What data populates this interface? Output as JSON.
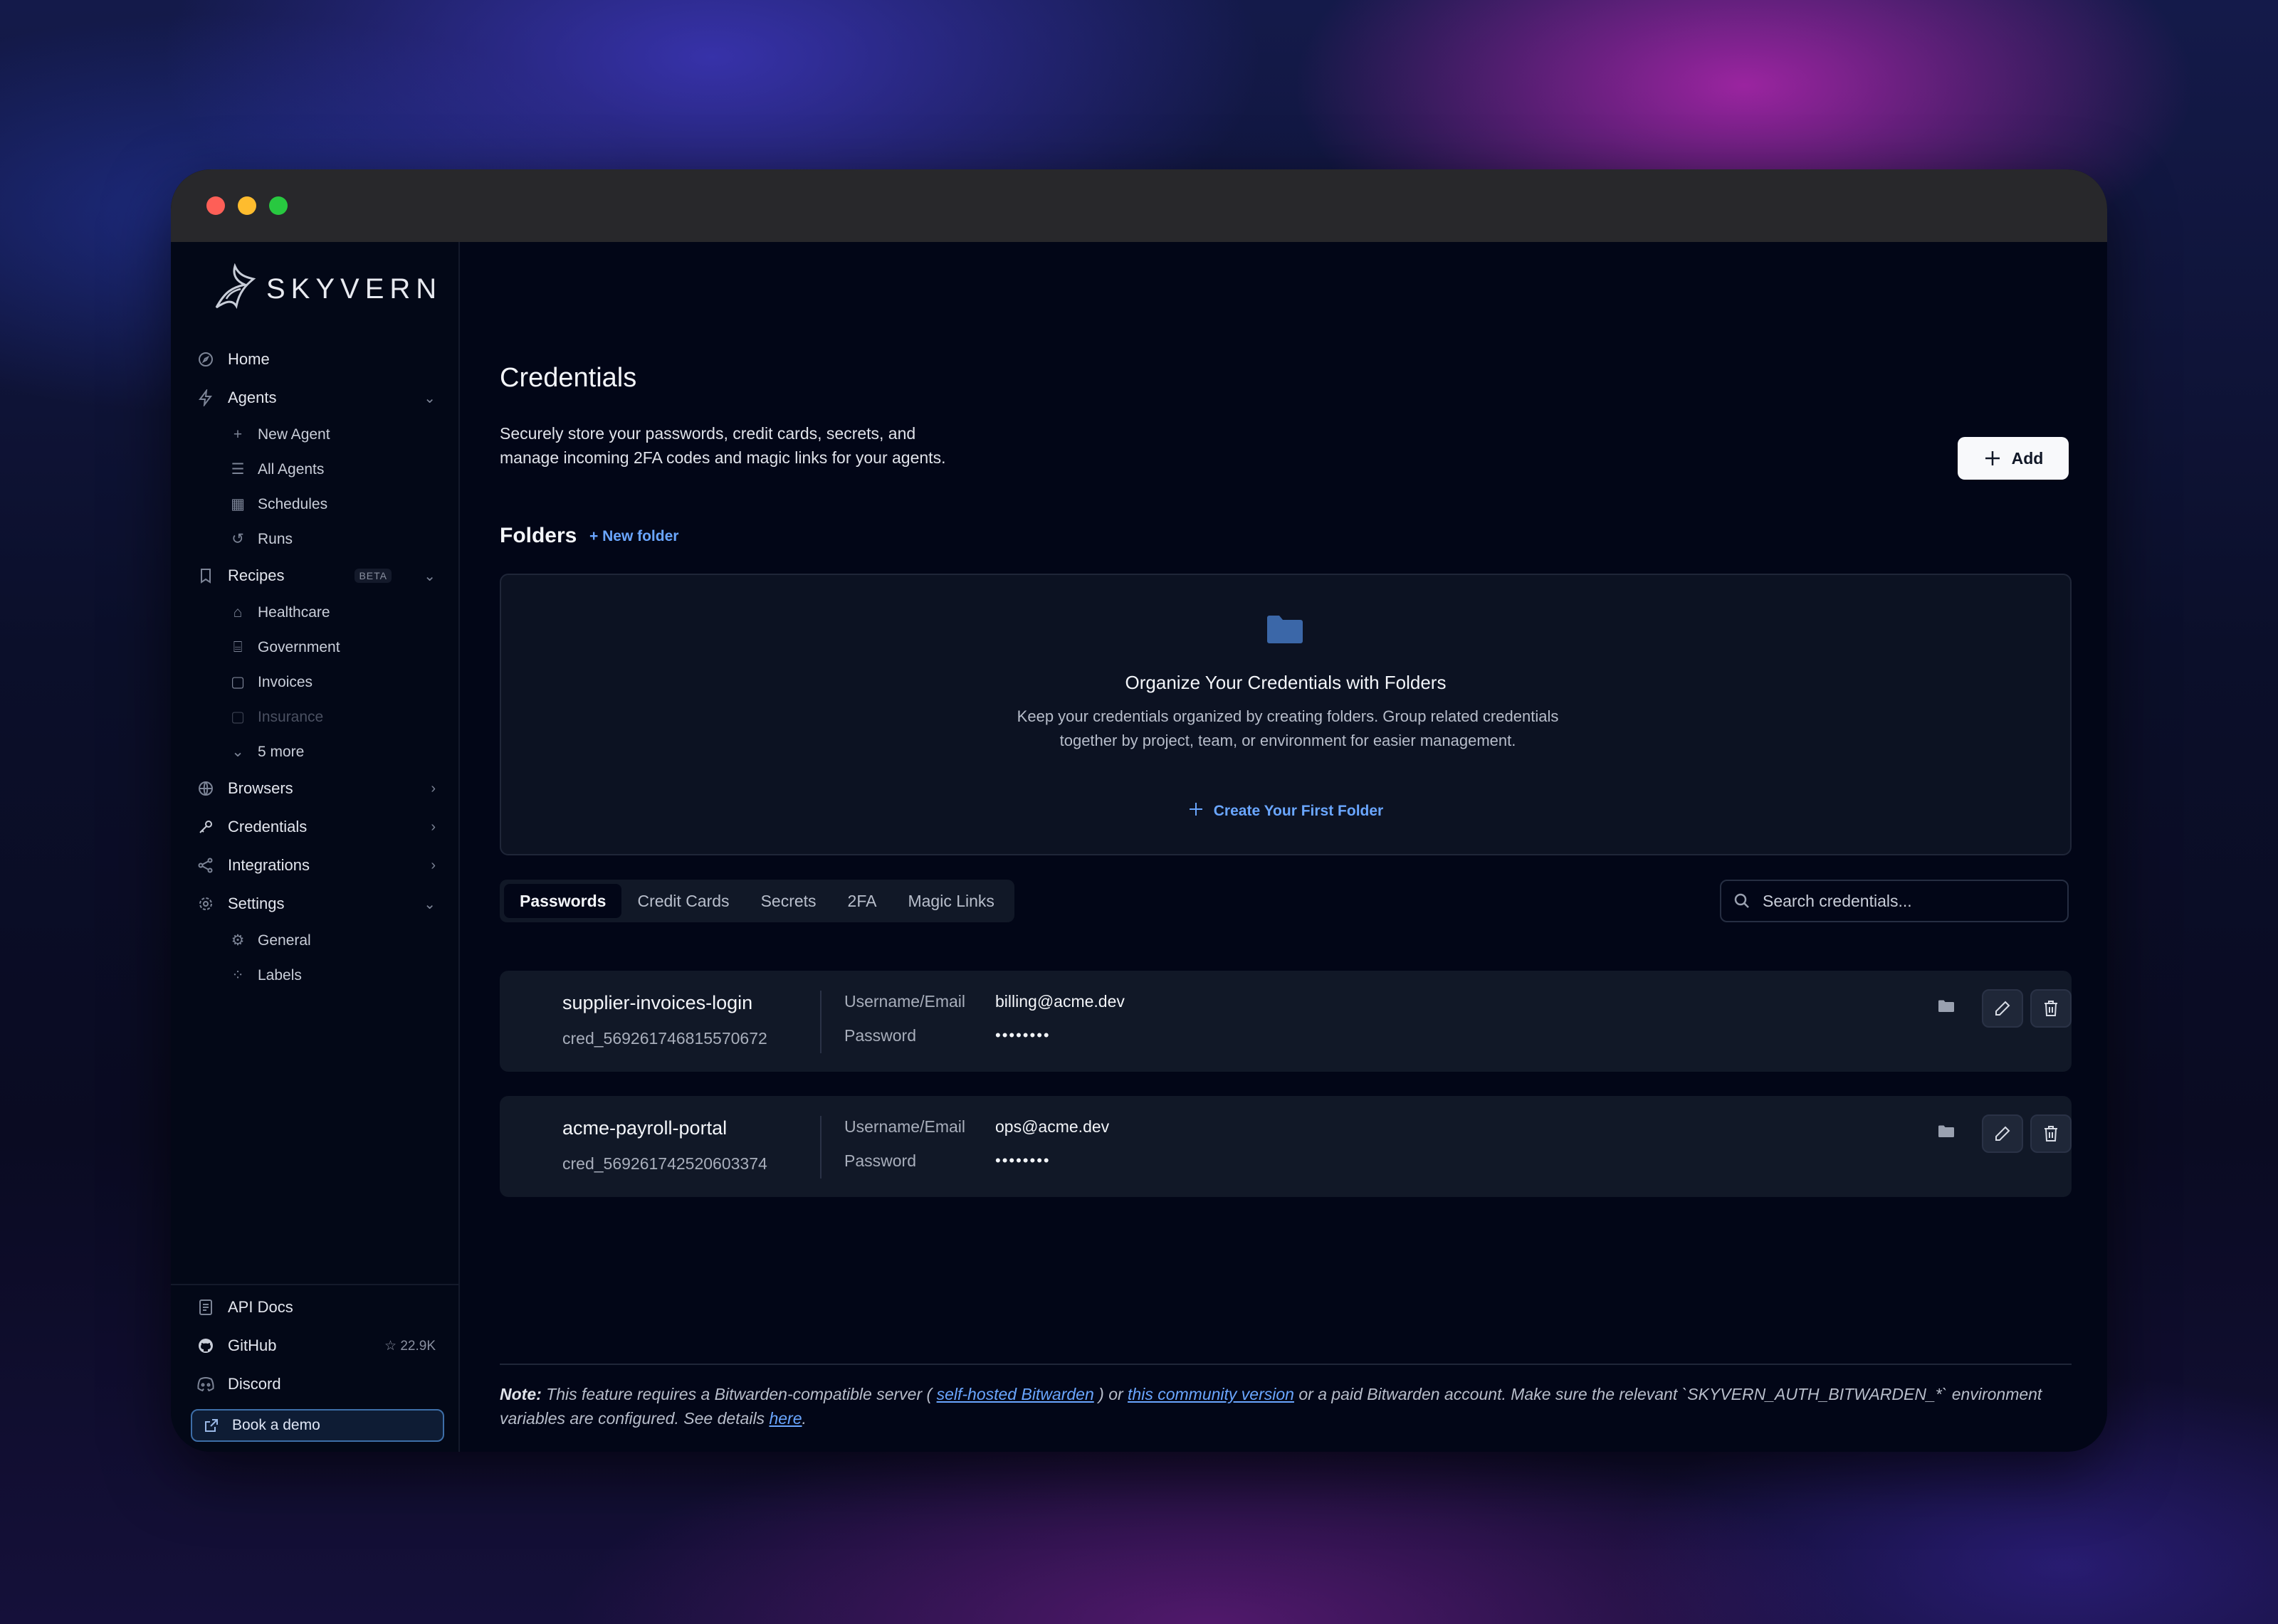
{
  "brand": {
    "name": "SKYVERN"
  },
  "sidebar": {
    "nav": [
      {
        "label": "Home",
        "icon": "compass-icon"
      },
      {
        "label": "Agents",
        "icon": "bolt-icon"
      }
    ],
    "agents_sub": [
      "New Agent",
      "All Agents",
      "Schedules",
      "Runs"
    ],
    "recipes": {
      "label": "Recipes",
      "badge": "BETA"
    },
    "recipes_sub": [
      "Healthcare",
      "Government",
      "Invoices",
      "Insurance",
      "5 more"
    ],
    "sections": [
      "Browsers",
      "Credentials",
      "Integrations",
      "Settings"
    ],
    "settings_sub": [
      "General",
      "Labels"
    ],
    "bottom": {
      "api_docs": "API Docs",
      "github": "GitHub",
      "github_stars": "☆ 22.9K",
      "discord": "Discord",
      "book_demo": "Book a demo"
    }
  },
  "page": {
    "title": "Credentials",
    "description": "Securely store your passwords, credit cards, secrets, and manage incoming 2FA codes and magic links for your agents.",
    "add_label": "Add"
  },
  "folders": {
    "title": "Folders",
    "new_folder": "+ New folder",
    "empty_title": "Organize Your Credentials with Folders",
    "empty_text": "Keep your credentials organized by creating folders. Group related credentials together by project, team, or environment for easier management.",
    "cta": "Create Your First Folder"
  },
  "tabs": [
    "Passwords",
    "Credit Cards",
    "Secrets",
    "2FA",
    "Magic Links"
  ],
  "search": {
    "placeholder": "Search credentials..."
  },
  "credentials": [
    {
      "name": "supplier-invoices-login",
      "id": "cred_569261746815570672",
      "user_label": "Username/Email",
      "user": "billing@acme.dev",
      "pass_label": "Password",
      "pass": "••••••••"
    },
    {
      "name": "acme-payroll-portal",
      "id": "cred_569261742520603374",
      "user_label": "Username/Email",
      "user": "ops@acme.dev",
      "pass_label": "Password",
      "pass": "••••••••"
    }
  ],
  "note": {
    "prefix": "Note:",
    "t1": " This feature requires a Bitwarden-compatible server ( ",
    "link1": "self-hosted Bitwarden",
    "t2": " ) or ",
    "link2": "this community version",
    "t3": " or a paid Bitwarden account. Make sure the relevant `SKYVERN_AUTH_BITWARDEN_*` environment variables are configured. See details ",
    "link3": "here",
    "t4": "."
  },
  "colors": {
    "accent": "#6aa6ff",
    "background": "#020617",
    "card": "#111827"
  }
}
